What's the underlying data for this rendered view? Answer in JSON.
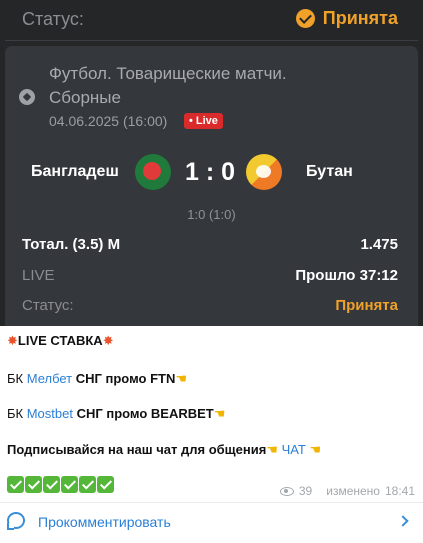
{
  "bet": {
    "top_status_label": "Статус:",
    "top_status_value": "Принята",
    "league": "Футбол. Товарищеские матчи. Сборные",
    "date": "04.06.2025 (16:00)",
    "live_badge": "• Live",
    "team1": "Бангладеш",
    "team2": "Бутан",
    "score": "1 : 0",
    "halftime": "1:0 (1:0)",
    "market": "Тотал. (3.5) М",
    "odds": "1.475",
    "live_label": "LIVE",
    "elapsed": "Прошло 37:12",
    "status_label": "Статус:",
    "status_value": "Принята"
  },
  "message": {
    "title": "LIVE СТАВКА",
    "line1": {
      "prefix": "БК ",
      "link": "Мелбет",
      "text": " СНГ промо ",
      "promo": "FTN"
    },
    "line2": {
      "prefix": "БК ",
      "link": "Mostbet",
      "text": " СНГ промо ",
      "promo": "BEARBET"
    },
    "line3": {
      "text": "Подписывайся на наш чат для общения",
      "link": "ЧАТ"
    },
    "check_count": 6
  },
  "meta": {
    "views": "39",
    "edited": "изменено",
    "time": "18:41"
  },
  "comment": {
    "label": "Прокомментировать"
  },
  "icons": [
    "check-circle-icon",
    "soccer-ball-icon",
    "flag-bangladesh-icon",
    "flag-bhutan-icon",
    "explosion-emoji-icon",
    "pointing-hand-icon",
    "check-mark-emoji-icon",
    "eye-icon",
    "comment-bubble-icon",
    "chevron-right-icon"
  ],
  "colors": {
    "accent_orange": "#f0a12a",
    "live_red": "#d92b2b",
    "link_blue": "#2b7fd6",
    "dark_bg": "#242628",
    "card_bg": "#34373b"
  }
}
